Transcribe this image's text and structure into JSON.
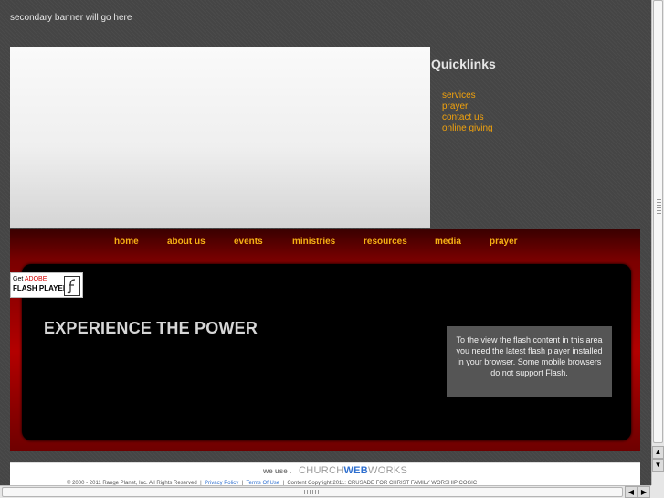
{
  "secondary_banner": "secondary banner will go here",
  "quicklinks": {
    "title": "Quicklinks",
    "items": [
      "services",
      "prayer",
      "contact us",
      "online giving"
    ]
  },
  "nav": {
    "items": [
      "home",
      "about us",
      "events",
      "ministries",
      "resources",
      "media",
      "prayer"
    ]
  },
  "get_flash": {
    "get": "Get",
    "adobe": "ADOBE",
    "product": "FLASH PLAYER"
  },
  "hero": {
    "headline": "EXPERIENCE THE POWER",
    "flash_message": "To the view the flash content in this area you need the latest flash player installed in your browser. Some mobile browsers do not support Flash."
  },
  "footer": {
    "we_use": "we use .",
    "logo_church": "CHURCH",
    "logo_web": "WEB",
    "logo_works": "WORKS",
    "copyright": "© 2000 - 2011 Range Planet, Inc. All Rights Reserved",
    "privacy": "Privacy Policy",
    "terms": "Terms Of Use",
    "content_copyright": "Content Copyright 2011: CRUSADE FOR CHRIST FAMILY WORSHIP COGIC"
  },
  "colors": {
    "page_bg": "#454545",
    "link_accent": "#f2a20c",
    "panel_red": "#b30000",
    "logo_blue": "#2e6fcf"
  },
  "icons": {
    "flash": "flash-f-icon",
    "scroll_up": "arrow-up-icon",
    "scroll_down": "arrow-down-icon",
    "scroll_left": "arrow-left-icon",
    "scroll_right": "arrow-right-icon"
  }
}
